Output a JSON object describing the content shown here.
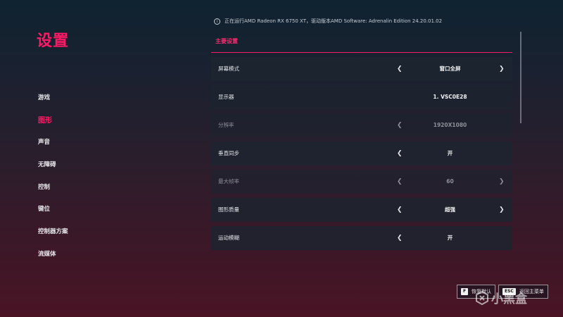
{
  "page_title": "设置",
  "driver_info": "正在运行AMD Radeon RX 6750 XT，驱动版本AMD Software: Adrenalin Edition 24.20.01.02",
  "section_tab": "主要设置",
  "nav": [
    {
      "label": "游戏",
      "active": false
    },
    {
      "label": "图形",
      "active": true
    },
    {
      "label": "声音",
      "active": false
    },
    {
      "label": "无障碍",
      "active": false
    },
    {
      "label": "控制",
      "active": false
    },
    {
      "label": "键位",
      "active": false
    },
    {
      "label": "控制器方案",
      "active": false
    },
    {
      "label": "流媒体",
      "active": false
    }
  ],
  "arrows": {
    "left": "❮",
    "right": "❯"
  },
  "settings": [
    {
      "label": "屏幕模式",
      "value": "窗口全屏",
      "left_arrow": true,
      "right_arrow": true,
      "disabled": false
    },
    {
      "label": "显示器",
      "value": "1. VSC0E28",
      "left_arrow": false,
      "right_arrow": false,
      "disabled": false
    },
    {
      "label": "分辨率",
      "value": "1920X1080",
      "left_arrow": true,
      "right_arrow": false,
      "disabled": true
    },
    {
      "label": "垂直同步",
      "value": "开",
      "left_arrow": true,
      "right_arrow": false,
      "disabled": false
    },
    {
      "label": "最大帧率",
      "value": "60",
      "left_arrow": true,
      "right_arrow": true,
      "disabled": true
    },
    {
      "label": "图形质量",
      "value": "超强",
      "left_arrow": true,
      "right_arrow": true,
      "disabled": false
    },
    {
      "label": "运动模糊",
      "value": "开",
      "left_arrow": true,
      "right_arrow": false,
      "disabled": false
    }
  ],
  "footer": {
    "restore_key": "F",
    "restore_label": "恢复默认",
    "back_key": "ESC",
    "back_label": "返回主菜单"
  },
  "watermark": "小黑盒",
  "colors": {
    "accent": "#ff1a66"
  }
}
